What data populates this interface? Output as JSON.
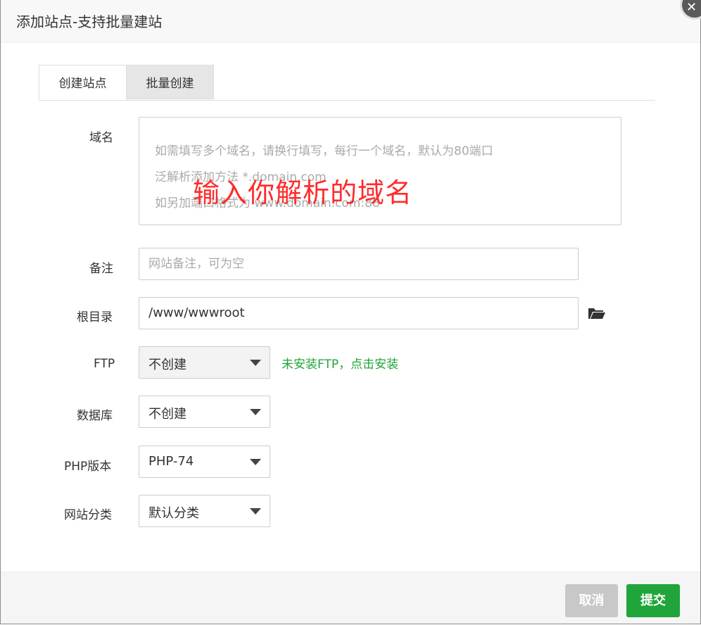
{
  "dialog": {
    "title": "添加站点-支持批量建站",
    "close_icon": "close-icon"
  },
  "tabs": [
    {
      "label": "创建站点",
      "active": true
    },
    {
      "label": "批量创建",
      "active": false
    }
  ],
  "form": {
    "domain": {
      "label": "域名",
      "placeholder_lines": [
        "如需填写多个域名，请换行填写，每行一个域名，默认为80端口",
        "泛解析添加方法 *.domain.com",
        "如另加端口格式为 www.domain.com:88"
      ],
      "annotation": "输入你解析的域名"
    },
    "remark": {
      "label": "备注",
      "placeholder": "网站备注，可为空"
    },
    "root": {
      "label": "根目录",
      "value": "/www/wwwroot",
      "icon": "folder-open-icon"
    },
    "ftp": {
      "label": "FTP",
      "value": "不创建",
      "link": "未安装FTP，点击安装"
    },
    "database": {
      "label": "数据库",
      "value": "不创建"
    },
    "php": {
      "label": "PHP版本",
      "value": "PHP-74"
    },
    "category": {
      "label": "网站分类",
      "value": "默认分类"
    }
  },
  "footer": {
    "cancel_label": "取消",
    "submit_label": "提交"
  },
  "colors": {
    "accent_green": "#20a53a",
    "annotation_red": "#ff2b2b",
    "cancel_grey": "#c8c8c8"
  }
}
